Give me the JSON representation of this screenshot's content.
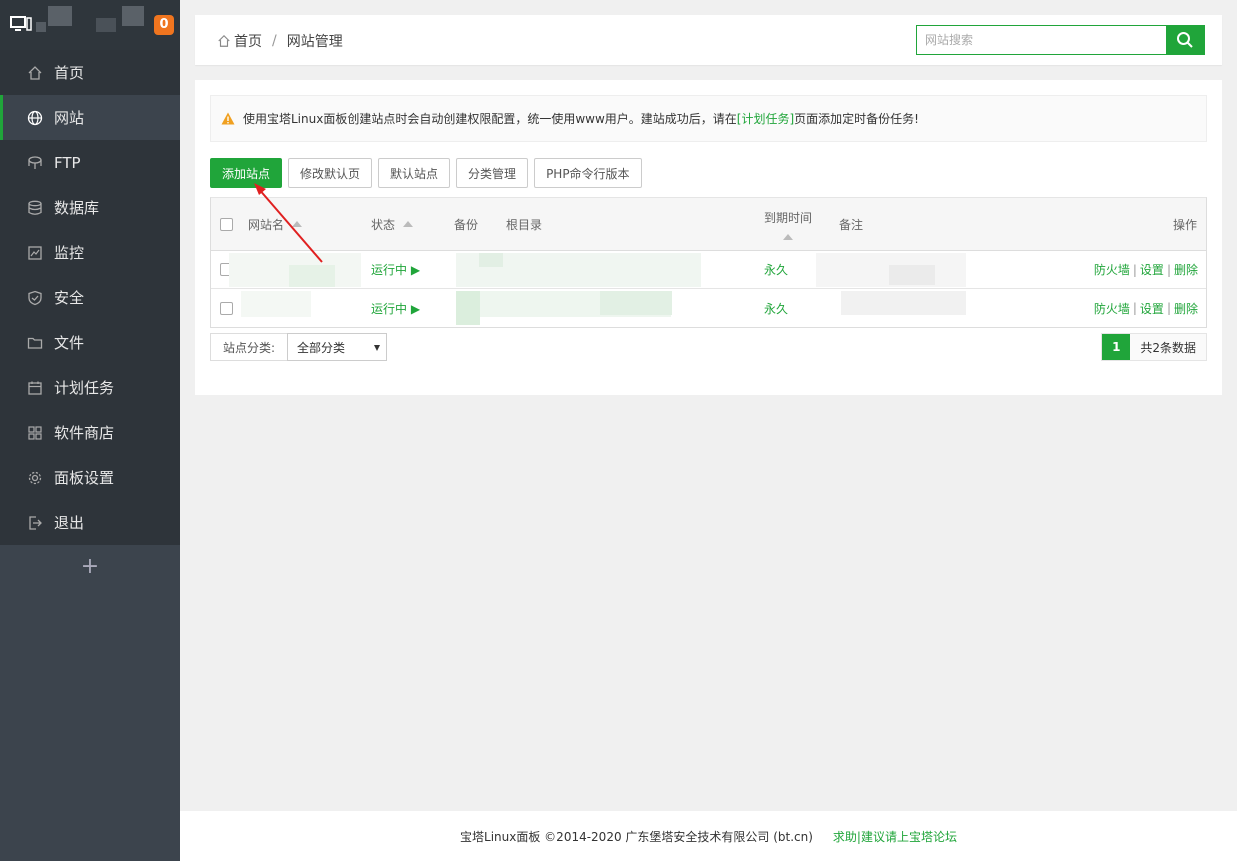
{
  "sidebar": {
    "badge": "0",
    "items": [
      {
        "label": "首页",
        "icon": "home-icon"
      },
      {
        "label": "网站",
        "icon": "globe-icon"
      },
      {
        "label": "FTP",
        "icon": "ftp-icon"
      },
      {
        "label": "数据库",
        "icon": "database-icon"
      },
      {
        "label": "监控",
        "icon": "monitor-icon"
      },
      {
        "label": "安全",
        "icon": "shield-icon"
      },
      {
        "label": "文件",
        "icon": "folder-icon"
      },
      {
        "label": "计划任务",
        "icon": "calendar-icon"
      },
      {
        "label": "软件商店",
        "icon": "grid-icon"
      },
      {
        "label": "面板设置",
        "icon": "gear-icon"
      },
      {
        "label": "退出",
        "icon": "logout-icon"
      }
    ],
    "active_index": 1,
    "plus": "+"
  },
  "breadcrumb": {
    "home": "首页",
    "separator": "/",
    "current": "网站管理"
  },
  "search": {
    "placeholder": "网站搜索"
  },
  "notice": {
    "text_before": "使用宝塔Linux面板创建站点时会自动创建权限配置，统一使用www用户。建站成功后，请在",
    "link": "[计划任务]",
    "text_after": "页面添加定时备份任务!"
  },
  "toolbar": {
    "add_site": "添加站点",
    "edit_default_page": "修改默认页",
    "default_site": "默认站点",
    "category_manage": "分类管理",
    "php_cli_version": "PHP命令行版本"
  },
  "table": {
    "headers": {
      "name": "网站名",
      "status": "状态",
      "backup": "备份",
      "root": "根目录",
      "expire": "到期时间",
      "note": "备注",
      "ops": "操作"
    },
    "rows": [
      {
        "status": "运行中 ▶",
        "expire": "永久",
        "op_firewall": "防火墙",
        "op_settings": "设置",
        "op_delete": "删除"
      },
      {
        "status": "运行中 ▶",
        "expire": "永久",
        "op_firewall": "防火墙",
        "op_settings": "设置",
        "op_delete": "删除"
      }
    ],
    "op_separator": "|"
  },
  "category": {
    "label": "站点分类:",
    "selected": "全部分类"
  },
  "pagination": {
    "current": "1",
    "total": "共2条数据"
  },
  "footer": {
    "copyright": "宝塔Linux面板 ©2014-2020 广东堡塔安全技术有限公司 (bt.cn)",
    "help": "求助|建议请上宝塔论坛"
  },
  "colors": {
    "accent": "#20a53a",
    "sidebar": "#3c444d",
    "badge": "#f0751f",
    "arrow": "#e02020"
  }
}
